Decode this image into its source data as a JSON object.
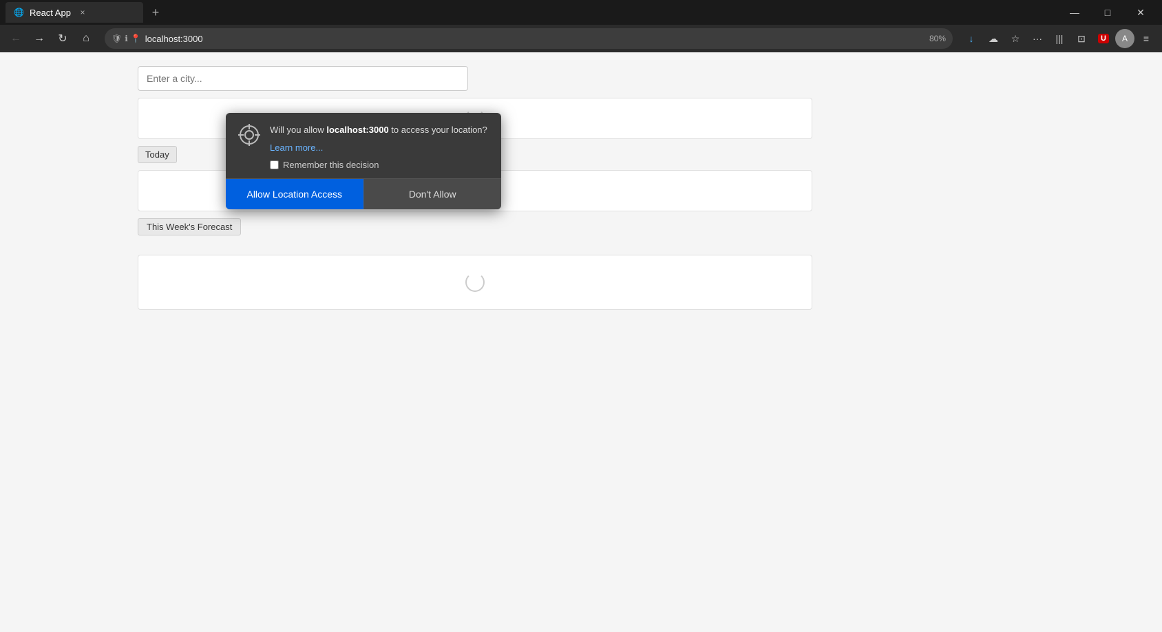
{
  "titleBar": {
    "tab": {
      "label": "React App",
      "close_label": "×",
      "new_tab_label": "+"
    },
    "windowControls": {
      "minimize": "—",
      "maximize": "□",
      "close": "✕"
    }
  },
  "navBar": {
    "back_label": "←",
    "forward_label": "→",
    "refresh_label": "↻",
    "home_label": "⌂",
    "address": "localhost:3000",
    "zoom": "80%",
    "more_label": "···",
    "star_label": "☆",
    "menu_label": "≡",
    "download_icon_label": "↓",
    "library_label": "|||",
    "split_label": "⊡",
    "avatar_label": "A",
    "badge_label": "U"
  },
  "locationPopup": {
    "question_prefix": "Will you allow ",
    "domain": "localhost:3000",
    "question_suffix": " to access your location?",
    "learn_more_label": "Learn more...",
    "remember_label": "Remember this decision",
    "allow_label": "Allow Location Access",
    "deny_label": "Don't Allow"
  },
  "webPage": {
    "city_input_placeholder": "Enter a city...",
    "today_label": "Today",
    "week_forecast_label": "This Week's Forecast"
  }
}
